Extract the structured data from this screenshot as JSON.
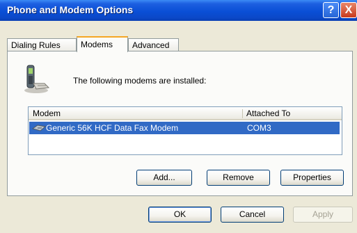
{
  "window": {
    "title": "Phone and Modem Options",
    "help_glyph": "?",
    "close_glyph": "X"
  },
  "tabs": [
    {
      "label": "Dialing Rules",
      "active": false
    },
    {
      "label": "Modems",
      "active": true
    },
    {
      "label": "Advanced",
      "active": false
    }
  ],
  "modems_tab": {
    "intro": "The following modems are installed:",
    "columns": [
      "Modem",
      "Attached To"
    ],
    "rows": [
      {
        "modem": "Generic 56K HCF Data Fax Modem",
        "attached_to": "COM3",
        "selected": true
      }
    ],
    "buttons": {
      "add": "Add...",
      "remove": "Remove",
      "properties": "Properties"
    }
  },
  "footer": {
    "ok": "OK",
    "cancel": "Cancel",
    "apply": "Apply"
  },
  "colors": {
    "title_bar": "#0a4fd6",
    "selection": "#316ac5",
    "face": "#ece9d8"
  }
}
